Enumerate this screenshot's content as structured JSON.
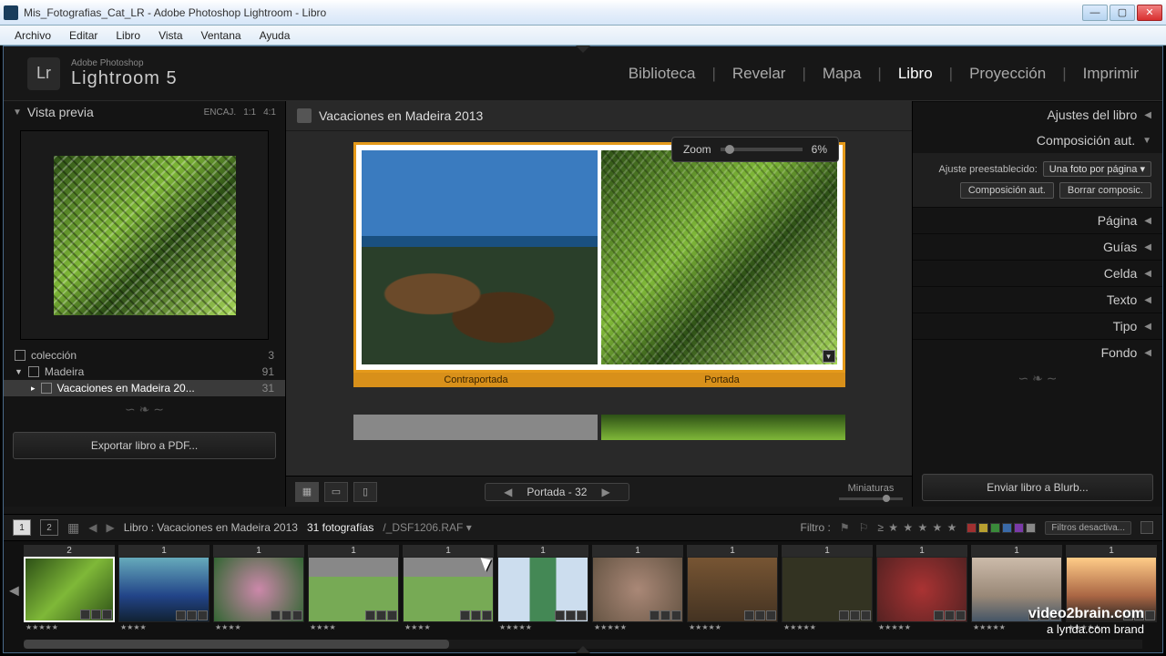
{
  "window": {
    "title": "Mis_Fotografias_Cat_LR - Adobe Photoshop Lightroom - Libro"
  },
  "menu": [
    "Archivo",
    "Editar",
    "Libro",
    "Vista",
    "Ventana",
    "Ayuda"
  ],
  "brand": {
    "logo": "Lr",
    "small": "Adobe Photoshop",
    "big": "Lightroom 5"
  },
  "modules": [
    "Biblioteca",
    "Revelar",
    "Mapa",
    "Libro",
    "Proyección",
    "Imprimir"
  ],
  "active_module": "Libro",
  "left": {
    "panel_title": "Vista previa",
    "fit_labels": [
      "ENCAJ.",
      "1:1",
      "4:1"
    ],
    "collections": [
      {
        "name": "colección",
        "count": "3",
        "level": 0
      },
      {
        "name": "Madeira",
        "count": "91",
        "level": 0,
        "expanded": true
      },
      {
        "name": "Vacaciones en Madeira 20...",
        "count": "31",
        "level": 1,
        "selected": true
      }
    ],
    "export_btn": "Exportar libro a PDF..."
  },
  "center": {
    "book_title": "Vacaciones en Madeira 2013",
    "zoom_label": "Zoom",
    "zoom_value": "6%",
    "back_label": "Contraportada",
    "front_label": "Portada",
    "pager_text": "Portada - 32",
    "mini_label": "Miniaturas"
  },
  "right": {
    "panels": {
      "ajustes": "Ajustes del libro",
      "compaut": "Composición aut.",
      "pagina": "Página",
      "guias": "Guías",
      "celda": "Celda",
      "texto": "Texto",
      "tipo": "Tipo",
      "fondo": "Fondo"
    },
    "preset_label": "Ajuste preestablecido:",
    "preset_value": "Una foto por página",
    "btn_auto": "Composición aut.",
    "btn_clear": "Borrar composic.",
    "send_btn": "Enviar libro a Blurb..."
  },
  "infobar": {
    "tabs": [
      "1",
      "2"
    ],
    "path": "Libro : Vacaciones en Madeira 2013",
    "count": "31 fotografías",
    "file": "/_DSF1206.RAF",
    "filter_label": "Filtro :",
    "filter_value": "Filtros desactiva..."
  },
  "swatch_colors": [
    "#a03030",
    "#b8a030",
    "#3a8a3a",
    "#3a6aa8",
    "#7a3aa8",
    "#888"
  ],
  "film": [
    {
      "n": "2",
      "cls": "t-fern",
      "r": "★★★★★",
      "sel": true
    },
    {
      "n": "1",
      "cls": "t-sea",
      "r": "★★★★"
    },
    {
      "n": "1",
      "cls": "t-flower",
      "r": "★★★★"
    },
    {
      "n": "1",
      "cls": "t-meadow",
      "r": "★★★★"
    },
    {
      "n": "1",
      "cls": "t-meadow",
      "r": "★★★★"
    },
    {
      "n": "1",
      "cls": "t-tree",
      "r": "★★★★★"
    },
    {
      "n": "1",
      "cls": "t-ground",
      "r": "★★★★★"
    },
    {
      "n": "1",
      "cls": "t-rock",
      "r": "★★★★★"
    },
    {
      "n": "1",
      "cls": "t-dark",
      "r": "★★★★★"
    },
    {
      "n": "1",
      "cls": "t-red",
      "r": "★★★★★"
    },
    {
      "n": "1",
      "cls": "t-cliff",
      "r": "★★★★★"
    },
    {
      "n": "1",
      "cls": "t-sunset",
      "r": "★★★★★"
    }
  ],
  "watermark": {
    "l1": "video2brain.com",
    "l2": "a lynda.com brand"
  }
}
